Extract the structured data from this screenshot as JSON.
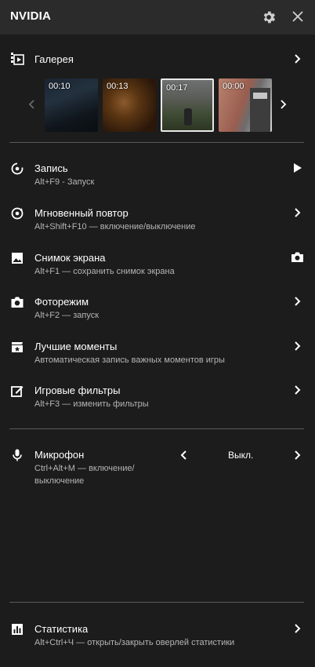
{
  "header": {
    "title": "NVIDIA"
  },
  "gallery": {
    "title": "Галерея",
    "thumbnails": [
      {
        "duration": "00:10"
      },
      {
        "duration": "00:13"
      },
      {
        "duration": "00:17"
      },
      {
        "duration": "00:00"
      }
    ]
  },
  "items": [
    {
      "title": "Запись",
      "subtitle": "Alt+F9 - Запуск"
    },
    {
      "title": "Мгновенный повтор",
      "subtitle": "Alt+Shift+F10 — включение/выключение"
    },
    {
      "title": "Снимок экрана",
      "subtitle": "Alt+F1 — сохранить снимок экрана"
    },
    {
      "title": "Фоторежим",
      "subtitle": "Alt+F2 — запуск"
    },
    {
      "title": "Лучшие моменты",
      "subtitle": "Автоматическая запись важных моментов игры"
    },
    {
      "title": "Игровые фильтры",
      "subtitle": "Alt+F3 — изменить фильтры"
    }
  ],
  "microphone": {
    "title": "Микрофон",
    "subtitle_line1": "Ctrl+Alt+M — включение/",
    "subtitle_line2": "выключение",
    "value": "Выкл."
  },
  "statistics": {
    "title": "Статистика",
    "subtitle": "Alt+Ctrl+Ч — открыть/закрыть оверлей статистики"
  },
  "colors": {
    "background": "#1c1c1c",
    "header": "#2b2b2b",
    "subtext": "#b5b5b5",
    "divider": "#5a5a5a"
  }
}
